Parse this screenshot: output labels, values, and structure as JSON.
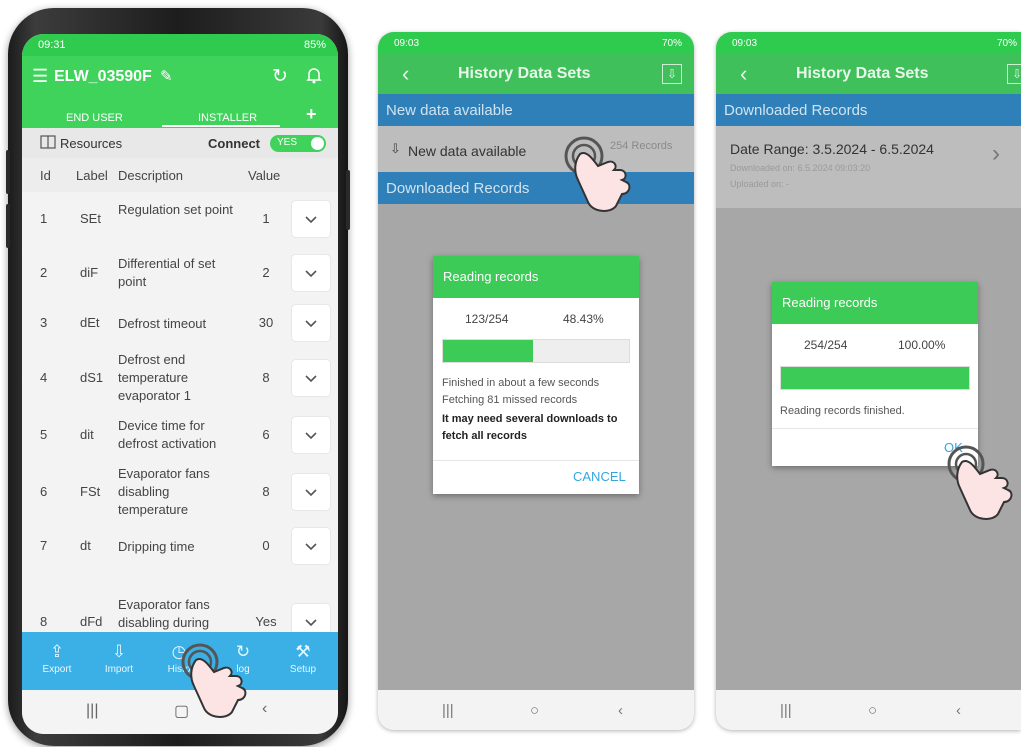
{
  "phone1": {
    "status": {
      "time": "09:31",
      "battery": "85%"
    },
    "appbar": {
      "title": "ELW_03590F"
    },
    "tabs": [
      {
        "label": "END USER"
      },
      {
        "label": "INSTALLER"
      }
    ],
    "resources_label": "Resources",
    "connect_label": "Connect",
    "connect_value": "YES",
    "table": {
      "headers": {
        "id": "Id",
        "label": "Label",
        "description": "Description",
        "value": "Value"
      },
      "rows": [
        {
          "id": "1",
          "label": "SEt",
          "description": "Regulation set point",
          "value": "1"
        },
        {
          "id": "2",
          "label": "diF",
          "description": "Differential of set point",
          "value": "2"
        },
        {
          "id": "3",
          "label": "dEt",
          "description": "Defrost timeout",
          "value": "30"
        },
        {
          "id": "4",
          "label": "dS1",
          "description": "Defrost end temperature evaporator 1",
          "value": "8"
        },
        {
          "id": "5",
          "label": "dit",
          "description": "Device time for defrost activation",
          "value": "6"
        },
        {
          "id": "6",
          "label": "FSt",
          "description": "Evaporator fans disabling temperature",
          "value": "8"
        },
        {
          "id": "7",
          "label": "dt",
          "description": "Dripping time",
          "value": "0"
        },
        {
          "id": "8",
          "label": "dFd",
          "description": "Evaporator fans disabling during",
          "value": "Yes"
        }
      ]
    },
    "bottom_nav": [
      {
        "label": "Export"
      },
      {
        "label": "Import"
      },
      {
        "label": "Histo"
      },
      {
        "label": "log"
      },
      {
        "label": "Setup"
      }
    ]
  },
  "phone2": {
    "status": {
      "time": "09:03",
      "battery": "70%"
    },
    "title": "History Data Sets",
    "section_new": "New data available",
    "new_data_label": "New data available",
    "records_count": "254 Records",
    "section_downloaded": "Downloaded Records",
    "dialog": {
      "title": "Reading records",
      "progress_count": "123/254",
      "progress_percent": "48.43%",
      "progress_fraction": 0.4843,
      "line1": "Finished in about a few seconds",
      "line2": "Fetching 81 missed records",
      "warning": "It may need several downloads to fetch all records",
      "cancel_label": "CANCEL"
    }
  },
  "phone3": {
    "status": {
      "time": "09:03",
      "battery": "70%"
    },
    "title": "History Data Sets",
    "section_downloaded": "Downloaded Records",
    "record": {
      "date_range": "Date Range: 3.5.2024 - 6.5.2024",
      "downloaded_on": "Downloaded on: 6.5.2024 09:03:20",
      "uploaded_on": "Uploaded on: -"
    },
    "dialog": {
      "title": "Reading records",
      "progress_count": "254/254",
      "progress_percent": "100.00%",
      "progress_fraction": 1.0,
      "message": "Reading records finished.",
      "ok_label": "OK"
    }
  },
  "colors": {
    "green": "#3fd35c",
    "blue_nav": "#3ab0e6",
    "section_blue": "#2f80b8",
    "gray_overlay": "#a7a7a7"
  }
}
